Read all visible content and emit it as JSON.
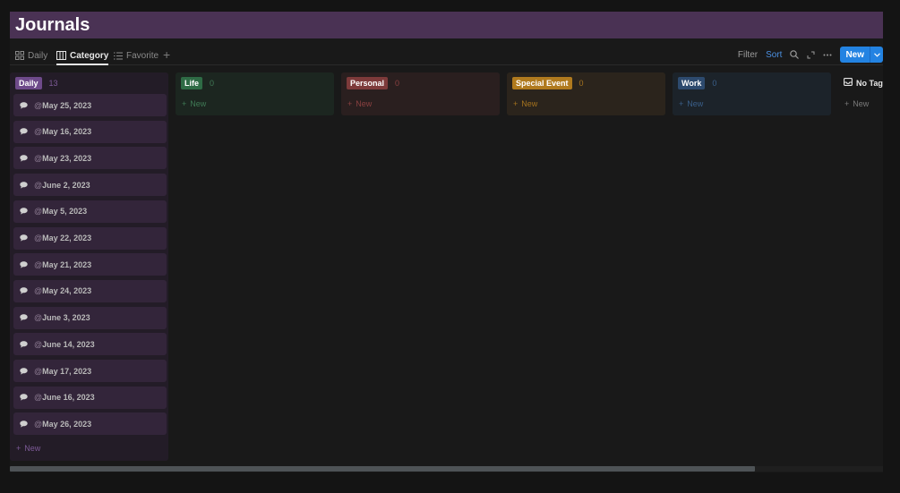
{
  "title": "Journals",
  "views": [
    {
      "label": "Daily",
      "icon": "board-grid-icon"
    },
    {
      "label": "Category",
      "icon": "board-columns-icon",
      "active": true
    },
    {
      "label": "Favorite",
      "icon": "list-icon"
    }
  ],
  "add_view": "+",
  "toolbar": {
    "filter": "Filter",
    "sort": "Sort",
    "new": "New"
  },
  "columns": [
    {
      "label": "Daily",
      "count": "13",
      "tag_color": "#6e4a8a",
      "bg": "#231c27",
      "count_color": "#7d5a98",
      "new_color": "#7d5a98",
      "new_label": "New"
    },
    {
      "label": "Life",
      "count": "0",
      "tag_color": "#2e6b45",
      "bg": "#1c2620",
      "count_color": "#3f7a55",
      "new_color": "#3f7a55",
      "new_label": "New"
    },
    {
      "label": "Personal",
      "count": "0",
      "tag_color": "#7d3a3a",
      "bg": "#2a1f1f",
      "count_color": "#8a4040",
      "new_color": "#8a4040",
      "new_label": "New"
    },
    {
      "label": "Special Event",
      "count": "0",
      "tag_color": "#b07a1e",
      "bg": "#2b241c",
      "count_color": "#a5731e",
      "new_color": "#a5731e",
      "new_label": "New"
    },
    {
      "label": "Work",
      "count": "0",
      "tag_color": "#2d4a6e",
      "bg": "#1c232a",
      "count_color": "#3a5f8a",
      "new_color": "#3a5f8a",
      "new_label": "New"
    },
    {
      "label": "No Tag",
      "count": "",
      "tag_color": "",
      "bg": "",
      "count_color": "#8a8a8a",
      "new_color": "#7a7a7a",
      "new_label": "New"
    }
  ],
  "daily_cards": [
    "May 25, 2023",
    "May 16, 2023",
    "May 23, 2023",
    "June 2, 2023",
    "May 5, 2023",
    "May 22, 2023",
    "May 21, 2023",
    "May 24, 2023",
    "June 3, 2023",
    "June 14, 2023",
    "May 17, 2023",
    "June 16, 2023",
    "May 26, 2023"
  ],
  "card_icon": "speech-bubble-icon",
  "scroll_progress": 0.853
}
